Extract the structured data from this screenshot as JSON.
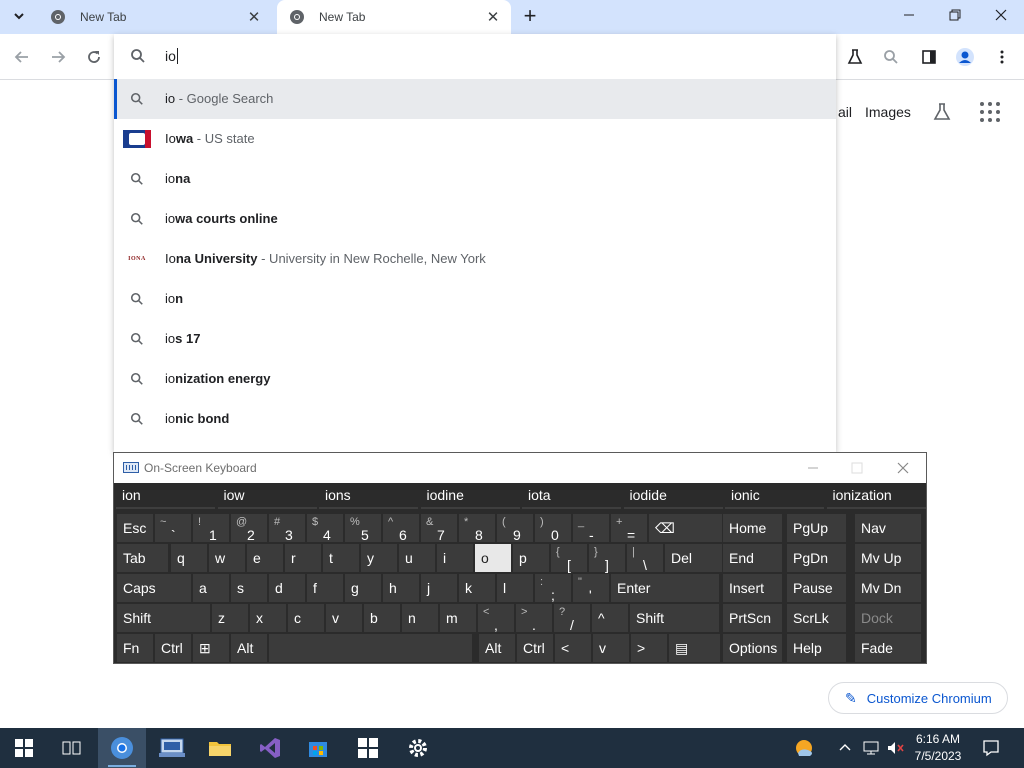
{
  "browser": {
    "tabs": [
      {
        "title": "New Tab",
        "active": false
      },
      {
        "title": "New Tab",
        "active": true
      }
    ],
    "new_tab_symbol": "+",
    "window_controls": {
      "minimize": "—",
      "restore": "❐",
      "close": "✕"
    }
  },
  "omnibox": {
    "value": "io",
    "suggestions": [
      {
        "typed": "io",
        "rest": "",
        "description": " - Google Search",
        "icon": "search-icon",
        "selected": true
      },
      {
        "typed": "Io",
        "rest": "wa",
        "description": " - US state",
        "icon": "iowa-flag-icon",
        "selected": false
      },
      {
        "typed": "io",
        "rest": "na",
        "description": "",
        "icon": "search-icon",
        "selected": false
      },
      {
        "typed": "io",
        "rest": "wa courts online",
        "description": "",
        "icon": "search-icon",
        "selected": false
      },
      {
        "typed": "Io",
        "rest": "na University",
        "description": " - University in New Rochelle, New York",
        "icon": "iona-logo-icon",
        "selected": false
      },
      {
        "typed": "io",
        "rest": "n",
        "description": "",
        "icon": "search-icon",
        "selected": false
      },
      {
        "typed": "io",
        "rest": "s 17",
        "description": "",
        "icon": "search-icon",
        "selected": false
      },
      {
        "typed": "io",
        "rest": "nization energy",
        "description": "",
        "icon": "search-icon",
        "selected": false
      },
      {
        "typed": "io",
        "rest": "nic bond",
        "description": "",
        "icon": "search-icon",
        "selected": false
      }
    ]
  },
  "page": {
    "gmail_link_partial": "ail",
    "images_link": "Images",
    "customize_label": "Customize Chromium",
    "iona_logo_text": "IONA"
  },
  "osk": {
    "title": "On-Screen Keyboard",
    "predictions": [
      "ion",
      "iow",
      "ions",
      "iodine",
      "iota",
      "iodide",
      "ionic",
      "ionization"
    ],
    "keys": [
      {
        "label": "Esc",
        "shift": ""
      },
      {
        "label": "`",
        "shift": "~"
      },
      {
        "label": "1",
        "shift": "!"
      },
      {
        "label": "2",
        "shift": "@"
      },
      {
        "label": "3",
        "shift": "#"
      },
      {
        "label": "4",
        "shift": "$"
      },
      {
        "label": "5",
        "shift": "%"
      },
      {
        "label": "6",
        "shift": "^"
      },
      {
        "label": "7",
        "shift": "&"
      },
      {
        "label": "8",
        "shift": "*"
      },
      {
        "label": "9",
        "shift": "("
      },
      {
        "label": "0",
        "shift": ")"
      },
      {
        "label": "-",
        "shift": "_"
      },
      {
        "label": "=",
        "shift": "+"
      },
      {
        "label": "⌫",
        "shift": ""
      },
      {
        "label": "Home",
        "shift": ""
      },
      {
        "label": "PgUp",
        "shift": ""
      },
      {
        "label": "Nav",
        "shift": ""
      },
      {
        "label": "Tab",
        "shift": ""
      },
      {
        "label": "q",
        "shift": ""
      },
      {
        "label": "w",
        "shift": ""
      },
      {
        "label": "e",
        "shift": ""
      },
      {
        "label": "r",
        "shift": ""
      },
      {
        "label": "t",
        "shift": ""
      },
      {
        "label": "y",
        "shift": ""
      },
      {
        "label": "u",
        "shift": ""
      },
      {
        "label": "i",
        "shift": ""
      },
      {
        "label": "o",
        "shift": ""
      },
      {
        "label": "p",
        "shift": ""
      },
      {
        "label": "[",
        "shift": "{"
      },
      {
        "label": "]",
        "shift": "}"
      },
      {
        "label": "\\",
        "shift": "|"
      },
      {
        "label": "Del",
        "shift": ""
      },
      {
        "label": "End",
        "shift": ""
      },
      {
        "label": "PgDn",
        "shift": ""
      },
      {
        "label": "Mv Up",
        "shift": ""
      },
      {
        "label": "Caps",
        "shift": ""
      },
      {
        "label": "a",
        "shift": ""
      },
      {
        "label": "s",
        "shift": ""
      },
      {
        "label": "d",
        "shift": ""
      },
      {
        "label": "f",
        "shift": ""
      },
      {
        "label": "g",
        "shift": ""
      },
      {
        "label": "h",
        "shift": ""
      },
      {
        "label": "j",
        "shift": ""
      },
      {
        "label": "k",
        "shift": ""
      },
      {
        "label": "l",
        "shift": ""
      },
      {
        "label": ";",
        "shift": ":"
      },
      {
        "label": "'",
        "shift": "\""
      },
      {
        "label": "Enter",
        "shift": ""
      },
      {
        "label": "Insert",
        "shift": ""
      },
      {
        "label": "Pause",
        "shift": ""
      },
      {
        "label": "Mv Dn",
        "shift": ""
      },
      {
        "label": "Shift",
        "shift": ""
      },
      {
        "label": "z",
        "shift": ""
      },
      {
        "label": "x",
        "shift": ""
      },
      {
        "label": "c",
        "shift": ""
      },
      {
        "label": "v",
        "shift": ""
      },
      {
        "label": "b",
        "shift": ""
      },
      {
        "label": "n",
        "shift": ""
      },
      {
        "label": "m",
        "shift": ""
      },
      {
        "label": ",",
        "shift": "<"
      },
      {
        "label": ".",
        "shift": ">"
      },
      {
        "label": "/",
        "shift": "?"
      },
      {
        "label": "^",
        "shift": ""
      },
      {
        "label": "Shift",
        "shift": ""
      },
      {
        "label": "PrtScn",
        "shift": ""
      },
      {
        "label": "ScrLk",
        "shift": ""
      },
      {
        "label": "Dock",
        "shift": ""
      },
      {
        "label": "Fn",
        "shift": ""
      },
      {
        "label": "Ctrl",
        "shift": ""
      },
      {
        "label": "⊞",
        "shift": ""
      },
      {
        "label": "Alt",
        "shift": ""
      },
      {
        "label": "",
        "shift": ""
      },
      {
        "label": "Alt",
        "shift": ""
      },
      {
        "label": "Ctrl",
        "shift": ""
      },
      {
        "label": "<",
        "shift": ""
      },
      {
        "label": "v",
        "shift": ""
      },
      {
        "label": ">",
        "shift": ""
      },
      {
        "label": "▤",
        "shift": ""
      },
      {
        "label": "Options",
        "shift": ""
      },
      {
        "label": "Help",
        "shift": ""
      },
      {
        "label": "Fade",
        "shift": ""
      }
    ]
  },
  "taskbar": {
    "time": "6:16 AM",
    "date": "7/5/2023"
  }
}
